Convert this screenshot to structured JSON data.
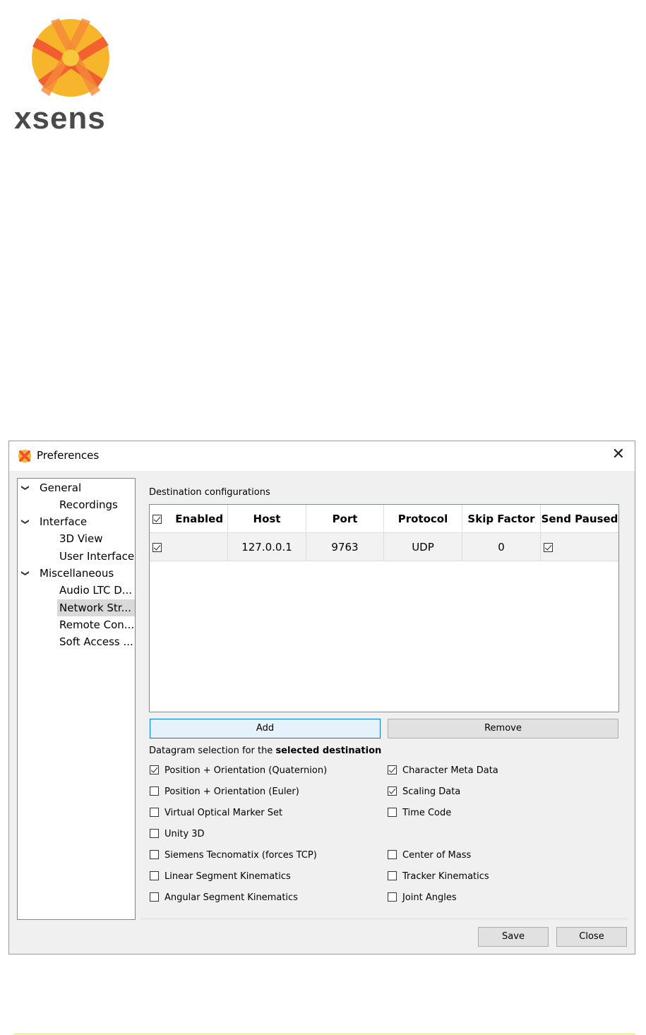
{
  "brand": {
    "name": "xsens",
    "logo_colors": [
      "#f5a623",
      "#f0532f",
      "#f7c93a"
    ]
  },
  "dialog": {
    "title": "Preferences",
    "close_glyph": "✕"
  },
  "tree": {
    "items": [
      {
        "label": "General",
        "level": 0,
        "expanded": true
      },
      {
        "label": "Recordings",
        "level": 1
      },
      {
        "label": "Interface",
        "level": 0,
        "expanded": true
      },
      {
        "label": "3D View",
        "level": 1
      },
      {
        "label": "User Interface",
        "level": 1
      },
      {
        "label": "Miscellaneous",
        "level": 0,
        "expanded": true
      },
      {
        "label": "Audio LTC D...",
        "level": 1
      },
      {
        "label": "Network Str...",
        "level": 1,
        "selected": true
      },
      {
        "label": "Remote Con...",
        "level": 1
      },
      {
        "label": "Soft Access ...",
        "level": 1
      }
    ]
  },
  "destinations": {
    "label": "Destination configurations",
    "columns": [
      "Enabled",
      "Host",
      "Port",
      "Protocol",
      "Skip Factor",
      "Send Paused"
    ],
    "header_checkbox_checked": true,
    "rows": [
      {
        "enabled": true,
        "host": "127.0.0.1",
        "port": "9763",
        "protocol": "UDP",
        "skip_factor": "0",
        "send_paused": true
      }
    ],
    "add_label": "Add",
    "remove_label": "Remove"
  },
  "datagram": {
    "label_prefix": "Datagram selection for the ",
    "label_bold": "selected destination",
    "left": [
      {
        "label": "Position + Orientation (Quaternion)",
        "checked": true
      },
      {
        "label": "Position + Orientation (Euler)",
        "checked": false
      },
      {
        "label": "Virtual Optical Marker Set",
        "checked": false
      },
      {
        "label": "Unity 3D",
        "checked": false
      },
      {
        "label": "Siemens Tecnomatix (forces TCP)",
        "checked": false
      },
      {
        "label": "Linear Segment Kinematics",
        "checked": false
      },
      {
        "label": "Angular Segment Kinematics",
        "checked": false
      }
    ],
    "right": [
      {
        "label": "Character Meta Data",
        "checked": true
      },
      {
        "label": "Scaling Data",
        "checked": true
      },
      {
        "label": "Time Code",
        "checked": false
      },
      {
        "label": "Center of Mass",
        "checked": false
      },
      {
        "label": "Tracker Kinematics",
        "checked": false
      },
      {
        "label": "Joint Angles",
        "checked": false
      }
    ]
  },
  "footer": {
    "save_label": "Save",
    "close_label": "Close"
  }
}
